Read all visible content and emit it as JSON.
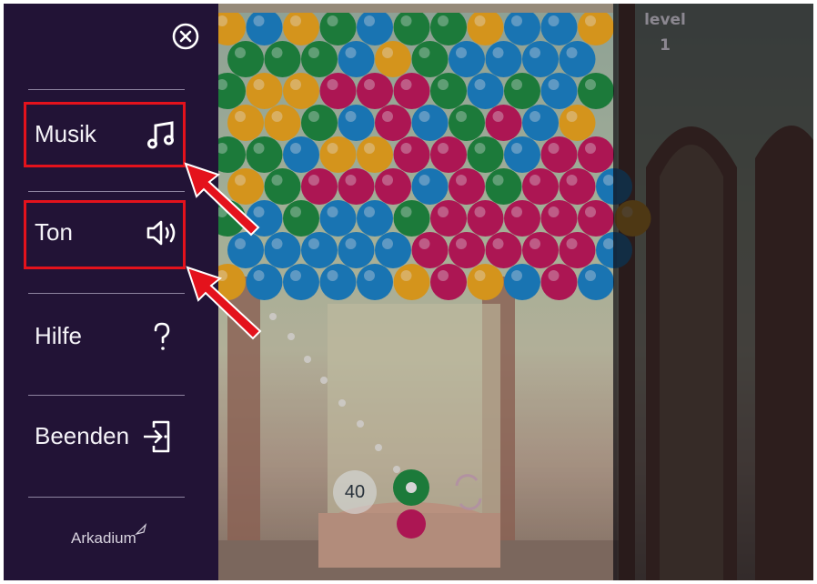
{
  "menu": {
    "items": [
      {
        "label": "Musik",
        "icon": "music-note-icon"
      },
      {
        "label": "Ton",
        "icon": "speaker-icon"
      },
      {
        "label": "Hilfe",
        "icon": "question-icon"
      },
      {
        "label": "Beenden",
        "icon": "exit-icon"
      }
    ],
    "close_icon": "close-icon",
    "brand": "Arkadium"
  },
  "game": {
    "level_label": "level",
    "level_value": "1",
    "shots_remaining": "40"
  },
  "colors": {
    "sidebar_bg": "#221336",
    "highlight": "#e4121c",
    "bubble_blue": "#1b83c6",
    "bubble_green": "#1e8a3e",
    "bubble_red": "#c2185b",
    "bubble_yellow": "#f0a81c"
  },
  "bubble_rows": [
    "YBYGBGGYBBY",
    "GGGBYGBBBB",
    "GYYRRRGBGBG",
    "YYGBRBGRBY",
    "GGBYYRRGBRR",
    "YGRRRBRGRRB",
    "GBGBBGRRRRRY",
    "BBBBBRRRRRB",
    "YBBBBYRYBRB"
  ]
}
